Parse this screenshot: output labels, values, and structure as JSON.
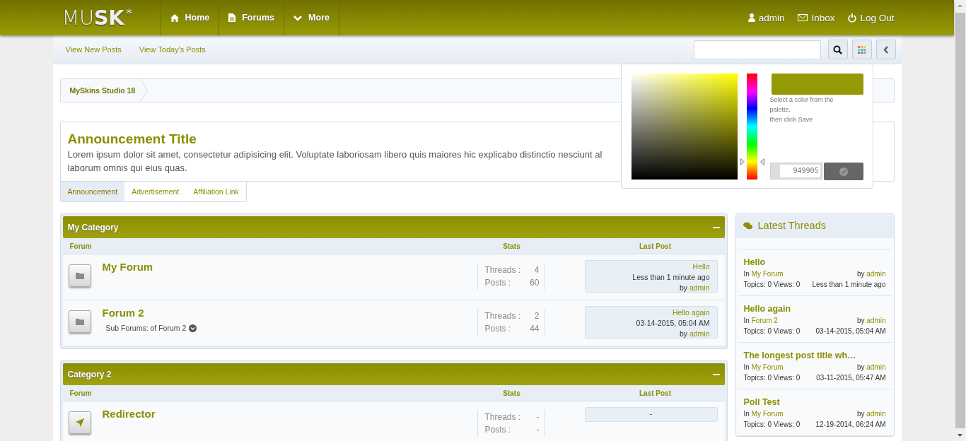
{
  "header": {
    "logo": {
      "light": "MU",
      "bold": "SK",
      "mark": "*"
    },
    "nav": [
      {
        "label": "Home"
      },
      {
        "label": "Forums"
      },
      {
        "label": "More"
      }
    ],
    "user_links": [
      {
        "label": "admin"
      },
      {
        "label": "Inbox"
      },
      {
        "label": "Log Out"
      }
    ]
  },
  "subnav": {
    "links": [
      "View New Posts",
      "View Today's Posts"
    ]
  },
  "color_picker": {
    "color": "#949905",
    "hue": {
      "level": 0.17
    },
    "hint_1": "Select a color from the palette,",
    "hint_2": "then click Save",
    "hex": "949905"
  },
  "breadcrumb": [
    "MySkins Studio 18"
  ],
  "announcement": {
    "title": "Announcement Title",
    "lines": [
      "Lorem ipsum dolor sit amet, consectetur adipisicing elit. Voluptate laboriosam libero quis maiores hic explicabo distinctio nesciunt al",
      "laborum omnis qui eius quas."
    ],
    "tabs": [
      {
        "label": "Announcement",
        "selected": true
      },
      {
        "label": "Advertisement",
        "selected": false
      },
      {
        "label": "Affiliation Link",
        "selected": false
      }
    ]
  },
  "categories": [
    {
      "title": "My Category",
      "expanded": true,
      "columns": [
        "Forum",
        "Stats",
        "Last Post"
      ],
      "forums": [
        {
          "name": "My Forum",
          "kind": "folder",
          "stats": [
            {
              "label": "Threads :",
              "value": "4"
            },
            {
              "label": "Posts :",
              "value": "60"
            }
          ],
          "last_post": {
            "title": "Hello",
            "time": "Less than 1 minute ago",
            "by": "by",
            "author": "admin"
          }
        },
        {
          "name": "Forum 2",
          "kind": "folder",
          "sub_forums": "Sub Forums: of Forum 2",
          "stats": [
            {
              "label": "Threads :",
              "value": "2"
            },
            {
              "label": "Posts :",
              "value": "44"
            }
          ],
          "last_post": {
            "title": "Hello again",
            "time": "03-14-2015, 05:04 AM",
            "by": "by",
            "author": "admin"
          }
        }
      ]
    },
    {
      "title": "Category 2",
      "expanded": true,
      "columns": [
        "Forum",
        "Stats",
        "Last Post"
      ],
      "forums": [
        {
          "name": "Redirector",
          "kind": "redirect",
          "stats": [
            {
              "label": "Threads :",
              "value": "-"
            },
            {
              "label": "Posts :",
              "value": "-"
            }
          ],
          "last_post": {
            "text": "-"
          }
        }
      ]
    }
  ],
  "latest_threads": {
    "title": "Latest Threads",
    "items": [
      {
        "title": "Hello",
        "in": "In",
        "forum": "My Forum",
        "by": "by",
        "author": "admin",
        "stats": "Topics: 0 Views: 0",
        "time": "Less than 1 minute ago"
      },
      {
        "title": "Hello again",
        "in": "In",
        "forum": "Forum 2",
        "by": "by",
        "author": "admin",
        "stats": "Topics: 0 Views: 0",
        "time": "03-14-2015, 05:04 AM"
      },
      {
        "title": "The longest post title wh…",
        "in": "In",
        "forum": "My Forum",
        "by": "by",
        "author": "admin",
        "stats": "Topics: 0 Views: 0",
        "time": "03-11-2015, 05:47 AM"
      },
      {
        "title": "Poll Test",
        "in": "In",
        "forum": "My Forum",
        "by": "by",
        "author": "admin",
        "stats": "Topics: 0 Views: 0",
        "time": "12-19-2014, 06:24 AM"
      }
    ]
  }
}
